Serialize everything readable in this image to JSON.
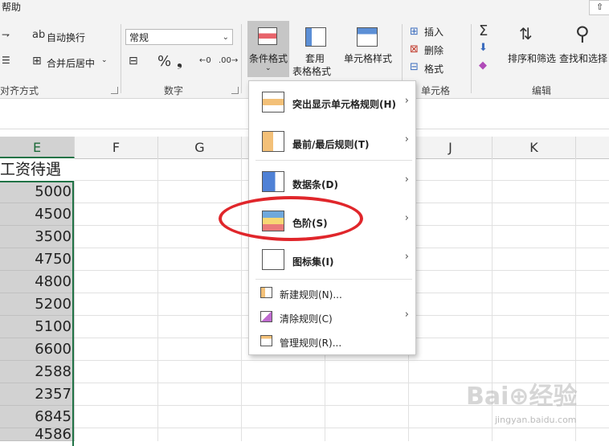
{
  "menu": {
    "help_tab": "帮助"
  },
  "ribbon": {
    "alignment": {
      "wrap_text": "自动换行",
      "merge_center": "合并后居中",
      "group_label": "对齐方式"
    },
    "number": {
      "format_value": "常规",
      "group_label": "数字",
      "percent": "%",
      "comma": "❟",
      "inc_decimal": "←0",
      "dec_decimal": ".00→"
    },
    "styles": {
      "conditional": "条件格式",
      "table1": "套用",
      "table2": "表格格式",
      "cell_styles": "单元格样式"
    },
    "cells": {
      "insert": "插入",
      "delete": "删除",
      "format": "格式",
      "group_label": "单元格"
    },
    "editing": {
      "sort_filter": "排序和筛选",
      "find_select": "查找和选择",
      "group_label": "编辑"
    }
  },
  "columns": [
    "E",
    "F",
    "G",
    "H",
    "I",
    "J",
    "K"
  ],
  "sheet": {
    "header_cell": "工资待遇",
    "values": [
      "5000",
      "4500",
      "3500",
      "4750",
      "4800",
      "5200",
      "5100",
      "6600",
      "2588",
      "2357",
      "6845",
      "4586"
    ]
  },
  "dropdown": {
    "items": [
      {
        "label": "突出显示单元格规则(H)",
        "arrow": "›"
      },
      {
        "label": "最前/最后规则(T)",
        "arrow": "›"
      },
      {
        "label": "数据条(D)",
        "arrow": "›"
      },
      {
        "label": "色阶(S)",
        "arrow": "›"
      },
      {
        "label": "图标集(I)",
        "arrow": "›"
      }
    ],
    "small_items": [
      {
        "label": "新建规则(N)...",
        "arrow": ""
      },
      {
        "label": "清除规则(C)",
        "arrow": "›"
      },
      {
        "label": "管理规则(R)...",
        "arrow": ""
      }
    ]
  },
  "watermark": {
    "main": "Bai⊕经验",
    "sub": "jingyan.baidu.com"
  },
  "colors": {
    "accent": "#217346",
    "highlight": "#e0262b",
    "selected_fill": "#d2d2d2"
  }
}
